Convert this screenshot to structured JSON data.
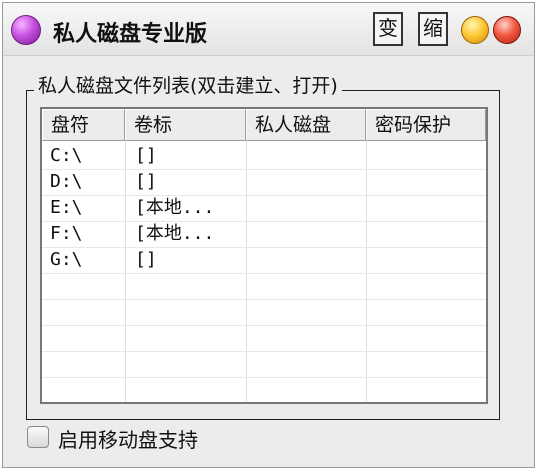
{
  "window": {
    "title": "私人磁盘专业版"
  },
  "titlebar_buttons": {
    "change": "变",
    "shrink": "缩"
  },
  "group": {
    "title": "私人磁盘文件列表(双击建立、打开)"
  },
  "list": {
    "columns": [
      "盘符",
      "卷标",
      "私人磁盘",
      "密码保护"
    ],
    "rows": [
      [
        "C:\\",
        "[]",
        "",
        ""
      ],
      [
        "D:\\",
        "[]",
        "",
        ""
      ],
      [
        "E:\\",
        "[本地...",
        "",
        ""
      ],
      [
        "F:\\",
        "[本地...",
        "",
        ""
      ],
      [
        "G:\\",
        "[]",
        "",
        ""
      ]
    ]
  },
  "options": {
    "removable_disk_support": "启用移动盘支持"
  },
  "icons": {
    "app": "purple-orb-icon",
    "minimize": "yellow-orb-icon",
    "close": "red-orb-icon"
  }
}
